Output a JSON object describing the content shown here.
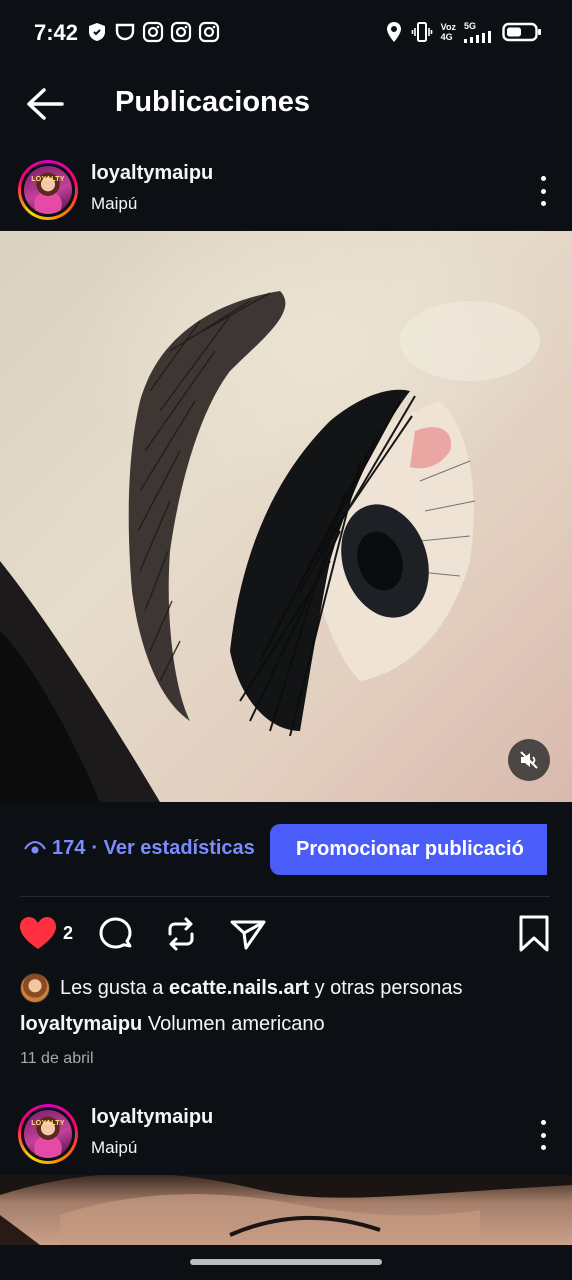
{
  "status_bar": {
    "time": "7:42",
    "network_line1": "Voz",
    "network_line2": "4G",
    "network_gen": "5G",
    "left_icons": [
      "shield-icon",
      "cup-icon",
      "instagram-icon",
      "instagram-icon",
      "instagram-icon"
    ],
    "right_icons": [
      "location-icon",
      "vibrate-icon",
      "signal-icon",
      "battery-icon"
    ]
  },
  "header": {
    "title": "Publicaciones",
    "back_icon": "arrow-left-icon"
  },
  "post": {
    "username": "loyaltymaipu",
    "location": "Maipú",
    "avatar_label": "LOYALTY",
    "views": "174",
    "insights_label": "· Ver estadísticas",
    "promote_label": "Promocionar publicació",
    "like_count": "2",
    "liked_by_prefix": "Les gusta a",
    "liked_by_user": "ecatte.nails.art",
    "liked_by_suffix": "y otras personas",
    "caption_user": "loyaltymaipu",
    "caption_text": "Volumen americano",
    "date": "11 de abril",
    "liked": true
  },
  "next_post": {
    "username": "loyaltymaipu",
    "location": "Maipú",
    "avatar_label": "LOYALTY"
  },
  "colors": {
    "background": "#0c1014",
    "accent": "#4a5df9",
    "link": "#7c8cff",
    "like": "#ff3040"
  }
}
